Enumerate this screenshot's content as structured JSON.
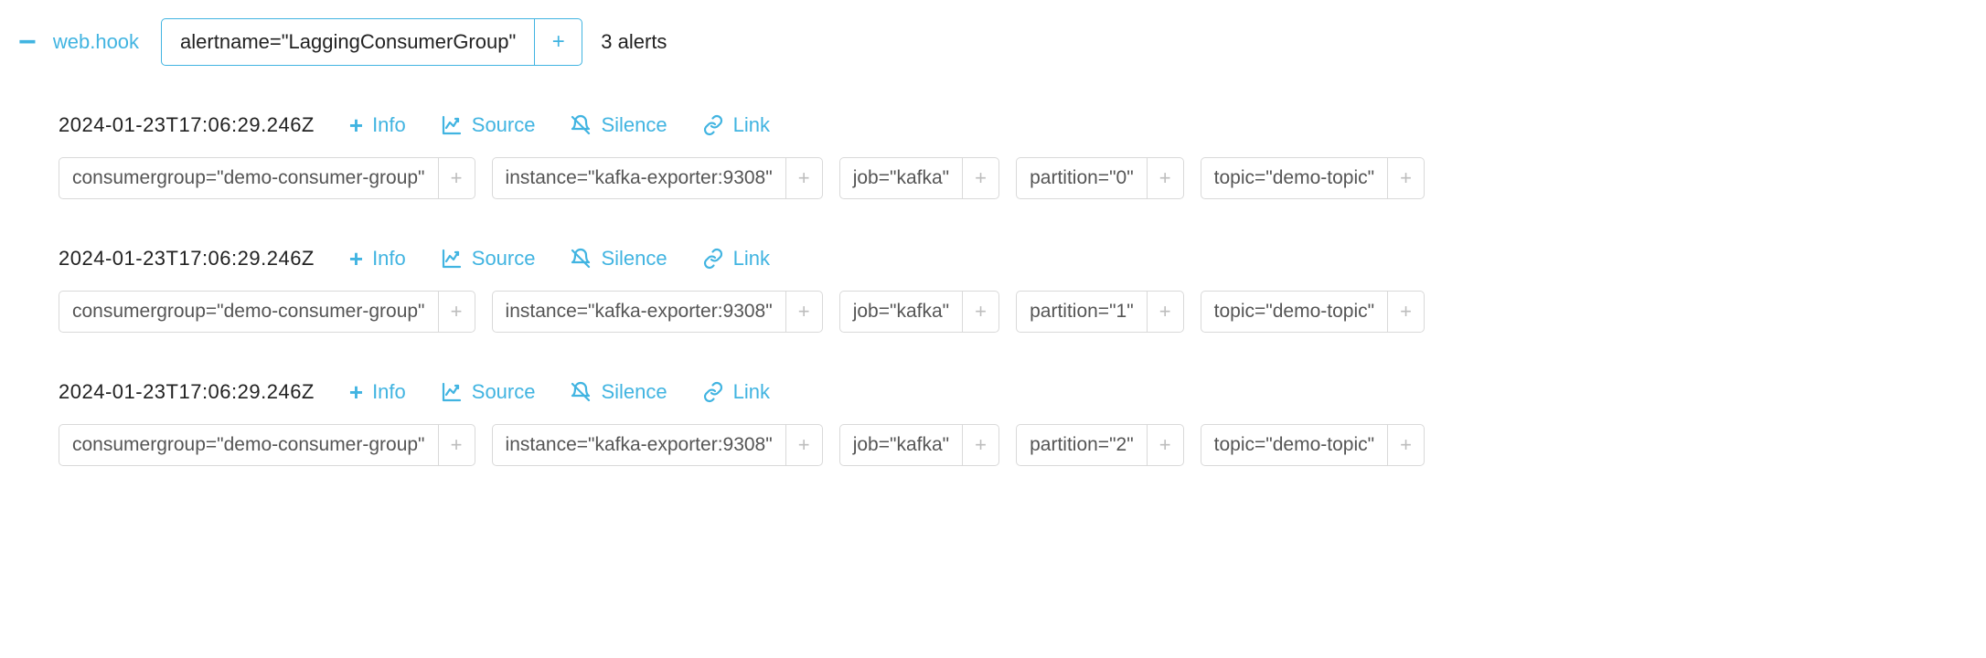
{
  "header": {
    "receiver": "web.hook",
    "filter_label": "alertname=\"LaggingConsumerGroup\"",
    "count_text": "3 alerts"
  },
  "actions": {
    "info": "Info",
    "source": "Source",
    "silence": "Silence",
    "link": "Link"
  },
  "alerts": [
    {
      "timestamp": "2024-01-23T17:06:29.246Z",
      "labels": [
        "consumergroup=\"demo-consumer-group\"",
        "instance=\"kafka-exporter:9308\"",
        "job=\"kafka\"",
        "partition=\"0\"",
        "topic=\"demo-topic\""
      ]
    },
    {
      "timestamp": "2024-01-23T17:06:29.246Z",
      "labels": [
        "consumergroup=\"demo-consumer-group\"",
        "instance=\"kafka-exporter:9308\"",
        "job=\"kafka\"",
        "partition=\"1\"",
        "topic=\"demo-topic\""
      ]
    },
    {
      "timestamp": "2024-01-23T17:06:29.246Z",
      "labels": [
        "consumergroup=\"demo-consumer-group\"",
        "instance=\"kafka-exporter:9308\"",
        "job=\"kafka\"",
        "partition=\"2\"",
        "topic=\"demo-topic\""
      ]
    }
  ]
}
